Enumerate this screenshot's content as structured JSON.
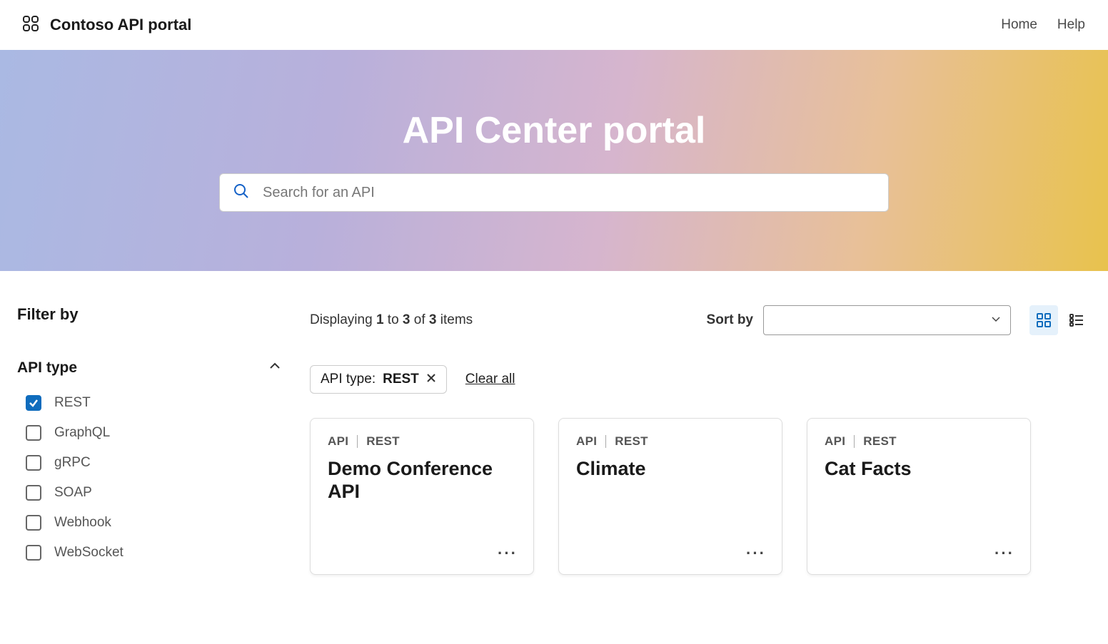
{
  "topbar": {
    "brand_title": "Contoso API portal",
    "nav": {
      "home": "Home",
      "help": "Help"
    }
  },
  "hero": {
    "title": "API Center portal",
    "search_placeholder": "Search for an API"
  },
  "sidebar": {
    "heading": "Filter by",
    "group": {
      "title": "API type",
      "options": {
        "0": {
          "label": "REST",
          "checked": true
        },
        "1": {
          "label": "GraphQL",
          "checked": false
        },
        "2": {
          "label": "gRPC",
          "checked": false
        },
        "3": {
          "label": "SOAP",
          "checked": false
        },
        "4": {
          "label": "Webhook",
          "checked": false
        },
        "5": {
          "label": "WebSocket",
          "checked": false
        }
      }
    }
  },
  "toolbar": {
    "displaying_prefix": "Displaying ",
    "from": "1",
    "to_word": " to ",
    "to": "3",
    "of_word": " of ",
    "total": "3",
    "items_word": " items",
    "sort_label": "Sort by",
    "sort_value": ""
  },
  "chips": {
    "label": "API type: ",
    "value": "REST",
    "clear_all": "Clear all"
  },
  "cards": {
    "tag_api": "API",
    "tag_rest": "REST",
    "0": {
      "title": "Demo Conference API"
    },
    "1": {
      "title": "Climate"
    },
    "2": {
      "title": "Cat Facts"
    }
  }
}
